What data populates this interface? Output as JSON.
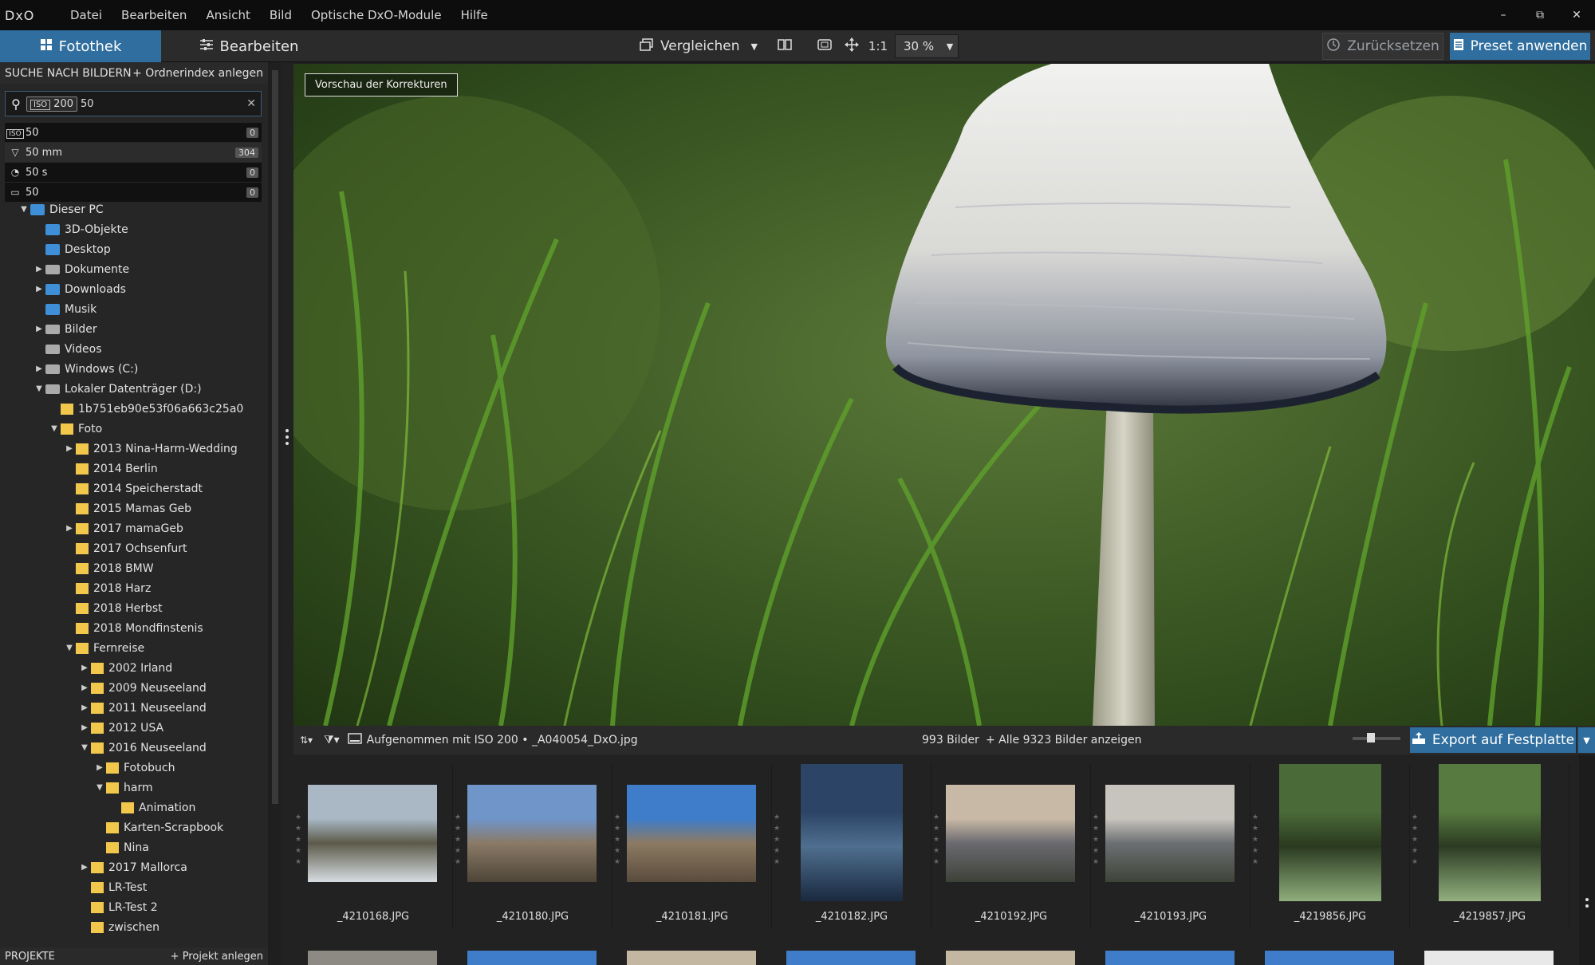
{
  "menu": {
    "logo": "DxO",
    "items": [
      "Datei",
      "Bearbeiten",
      "Ansicht",
      "Bild",
      "Optische DxO-Module",
      "Hilfe"
    ],
    "window": {
      "minimize": "–",
      "restore": "⧉",
      "close": "✕"
    }
  },
  "toolbar": {
    "tab_library": "Fotothek",
    "tab_edit": "Bearbeiten",
    "compare": "Vergleichen",
    "one_to_one": "1:1",
    "zoom": "30 %",
    "reset": "Zurücksetzen",
    "apply_preset": "Preset anwenden"
  },
  "sidebar": {
    "search_title": "SUCHE NACH BILDERN",
    "add_index": "+ Ordnerindex anlegen",
    "search": {
      "chip_label": "ISO",
      "chip_value": "200",
      "query": "50"
    },
    "suggestions": [
      {
        "icon": "ISO",
        "label": "50",
        "count": "0"
      },
      {
        "icon": "▽",
        "label": "50 mm",
        "count": "304"
      },
      {
        "icon": "◔",
        "label": "50 s",
        "count": "0"
      },
      {
        "icon": "▭",
        "label": "50",
        "count": "0"
      }
    ],
    "projects_title": "PROJEKTE",
    "add_project": "+ Projekt anlegen"
  },
  "tree": [
    {
      "label": "Dieser PC",
      "level": 1,
      "arrow": "▼",
      "icon": "pc"
    },
    {
      "label": "3D-Objekte",
      "level": 2,
      "arrow": "",
      "icon": "pc"
    },
    {
      "label": "Desktop",
      "level": 2,
      "arrow": "",
      "icon": "pc"
    },
    {
      "label": "Dokumente",
      "level": 2,
      "arrow": "▶",
      "icon": "drive"
    },
    {
      "label": "Downloads",
      "level": 2,
      "arrow": "▶",
      "icon": "pc"
    },
    {
      "label": "Musik",
      "level": 2,
      "arrow": "",
      "icon": "pc"
    },
    {
      "label": "Bilder",
      "level": 2,
      "arrow": "▶",
      "icon": "drive"
    },
    {
      "label": "Videos",
      "level": 2,
      "arrow": "",
      "icon": "drive"
    },
    {
      "label": "Windows (C:)",
      "level": 2,
      "arrow": "▶",
      "icon": "drive"
    },
    {
      "label": "Lokaler Datenträger (D:)",
      "level": 2,
      "arrow": "▼",
      "icon": "drive"
    },
    {
      "label": "1b751eb90e53f06a663c25a0",
      "level": 3,
      "arrow": "",
      "icon": "folder"
    },
    {
      "label": "Foto",
      "level": 3,
      "arrow": "▼",
      "icon": "folder"
    },
    {
      "label": "2013 Nina-Harm-Wedding",
      "level": 4,
      "arrow": "▶",
      "icon": "folder"
    },
    {
      "label": "2014 Berlin",
      "level": 4,
      "arrow": "",
      "icon": "folder"
    },
    {
      "label": "2014 Speicherstadt",
      "level": 4,
      "arrow": "",
      "icon": "folder"
    },
    {
      "label": "2015 Mamas Geb",
      "level": 4,
      "arrow": "",
      "icon": "folder"
    },
    {
      "label": "2017 mamaGeb",
      "level": 4,
      "arrow": "▶",
      "icon": "folder"
    },
    {
      "label": "2017 Ochsenfurt",
      "level": 4,
      "arrow": "",
      "icon": "folder"
    },
    {
      "label": "2018 BMW",
      "level": 4,
      "arrow": "",
      "icon": "folder"
    },
    {
      "label": "2018 Harz",
      "level": 4,
      "arrow": "",
      "icon": "folder"
    },
    {
      "label": "2018 Herbst",
      "level": 4,
      "arrow": "",
      "icon": "folder"
    },
    {
      "label": "2018 Mondfinstenis",
      "level": 4,
      "arrow": "",
      "icon": "folder"
    },
    {
      "label": "Fernreise",
      "level": 4,
      "arrow": "▼",
      "icon": "folder"
    },
    {
      "label": "2002 Irland",
      "level": 5,
      "arrow": "▶",
      "icon": "folder"
    },
    {
      "label": "2009 Neuseeland",
      "level": 5,
      "arrow": "▶",
      "icon": "folder"
    },
    {
      "label": "2011 Neuseeland",
      "level": 5,
      "arrow": "▶",
      "icon": "folder"
    },
    {
      "label": "2012 USA",
      "level": 5,
      "arrow": "▶",
      "icon": "folder"
    },
    {
      "label": "2016 Neuseeland",
      "level": 5,
      "arrow": "▼",
      "icon": "folder"
    },
    {
      "label": "Fotobuch",
      "level": 6,
      "arrow": "▶",
      "icon": "folder"
    },
    {
      "label": "harm",
      "level": 6,
      "arrow": "▼",
      "icon": "folder"
    },
    {
      "label": "Animation",
      "level": 7,
      "arrow": "",
      "icon": "folder"
    },
    {
      "label": "Karten-Scrapbook",
      "level": 6,
      "arrow": "",
      "icon": "folder"
    },
    {
      "label": "Nina",
      "level": 6,
      "arrow": "",
      "icon": "folder"
    },
    {
      "label": "2017 Mallorca",
      "level": 5,
      "arrow": "▶",
      "icon": "folder"
    },
    {
      "label": "LR-Test",
      "level": 5,
      "arrow": "",
      "icon": "folder"
    },
    {
      "label": "LR-Test 2",
      "level": 5,
      "arrow": "",
      "icon": "folder"
    },
    {
      "label": "zwischen",
      "level": 5,
      "arrow": "",
      "icon": "folder"
    }
  ],
  "viewer": {
    "preview_button": "Vorschau der Korrekturen"
  },
  "stripbar": {
    "info": "Aufgenommen mit ISO 200  •  _A040054_DxO.jpg",
    "count": "993 Bilder",
    "show_all": "+ Alle 9323 Bilder anzeigen",
    "export": "Export auf Festplatte"
  },
  "thumbnails": [
    {
      "name": "_4210168.JPG",
      "colors": [
        "#a9b8c4",
        "#5c5a4a",
        "#d7dde2"
      ],
      "portrait": false
    },
    {
      "name": "_4210180.JPG",
      "colors": [
        "#6f95c9",
        "#8a7a66",
        "#4e4538"
      ],
      "portrait": false
    },
    {
      "name": "_4210181.JPG",
      "colors": [
        "#3f7cc9",
        "#8c7a62",
        "#5a4c3d"
      ],
      "portrait": false
    },
    {
      "name": "_4210182.JPG",
      "colors": [
        "#2c4466",
        "#4f6f8f",
        "#1a2a40"
      ],
      "portrait": true
    },
    {
      "name": "_4210192.JPG",
      "colors": [
        "#c8b9a6",
        "#6b6a70",
        "#3d4238"
      ],
      "portrait": false
    },
    {
      "name": "_4210193.JPG",
      "colors": [
        "#c7c3bd",
        "#6c6f72",
        "#3e4438"
      ],
      "portrait": false
    },
    {
      "name": "_4219856.JPG",
      "colors": [
        "#4a6a38",
        "#2a3a20",
        "#8fae7c"
      ],
      "portrait": true
    },
    {
      "name": "_4219857.JPG",
      "colors": [
        "#567a40",
        "#2b3b22",
        "#93b07e"
      ],
      "portrait": true
    }
  ],
  "colors": {
    "accent": "#2f6e9e",
    "menubar": "#0d0d0d",
    "panel": "#262626"
  }
}
